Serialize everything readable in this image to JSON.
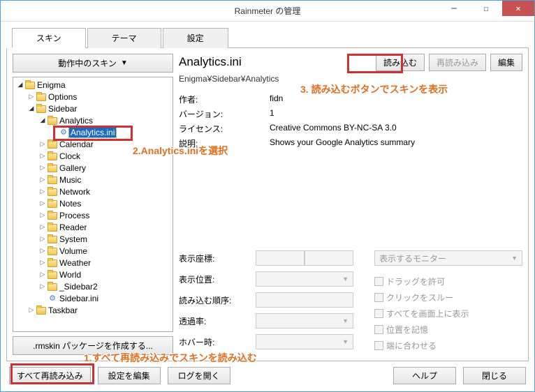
{
  "window": {
    "title": "Rainmeter の管理"
  },
  "tabs": {
    "skins": "スキン",
    "themes": "テーマ",
    "settings": "設定"
  },
  "left": {
    "active_skins": "動作中のスキン",
    "create_rmskin": ".rmskin パッケージを作成する...",
    "tree": {
      "root": "Enigma",
      "options": "Options",
      "sidebar": "Sidebar",
      "analytics_folder": "Analytics",
      "analytics_ini": "Analytics.ini",
      "calendar": "Calendar",
      "clock": "Clock",
      "gallery": "Gallery",
      "music": "Music",
      "network": "Network",
      "notes": "Notes",
      "process": "Process",
      "reader": "Reader",
      "system": "System",
      "volume": "Volume",
      "weather": "Weather",
      "world": "World",
      "sidebar2": "_Sidebar2",
      "sidebar_ini": "Sidebar.ini",
      "taskbar": "Taskbar"
    }
  },
  "header": {
    "title": "Analytics.ini",
    "crumb": "Enigma¥Sidebar¥Analytics",
    "load": "読み込む",
    "reload": "再読み込み",
    "edit": "編集"
  },
  "info": {
    "author_k": "作者:",
    "author_v": "fidn",
    "version_k": "バージョン:",
    "version_v": "1",
    "license_k": "ライセンス:",
    "license_v": "Creative Commons BY-NC-SA 3.0",
    "desc_k": "説明:",
    "desc_v": "Shows your Google Analytics summary"
  },
  "settings": {
    "coord_k": "表示座標:",
    "pos_k": "表示位置:",
    "loadorder_k": "読み込む順序:",
    "trans_k": "透過率:",
    "hover_k": "ホバー時:",
    "monitor": "表示するモニター",
    "checks": {
      "drag": "ドラッグを許可",
      "click": "クリックをスルー",
      "ontop": "すべてを画面上に表示",
      "savepos": "位置を記憶",
      "snap": "端に合わせる"
    }
  },
  "footer": {
    "reload_all": "すべて再読み込み",
    "edit_settings": "設定を編集",
    "open_log": "ログを開く",
    "help": "ヘルプ",
    "close": "閉じる"
  },
  "annotations": {
    "step1": "1.すべて再読み込みでスキンを読み込む",
    "step2": "2.Analytics.iniを選択",
    "step3": "3.  読み込むボタンでスキンを表示"
  }
}
